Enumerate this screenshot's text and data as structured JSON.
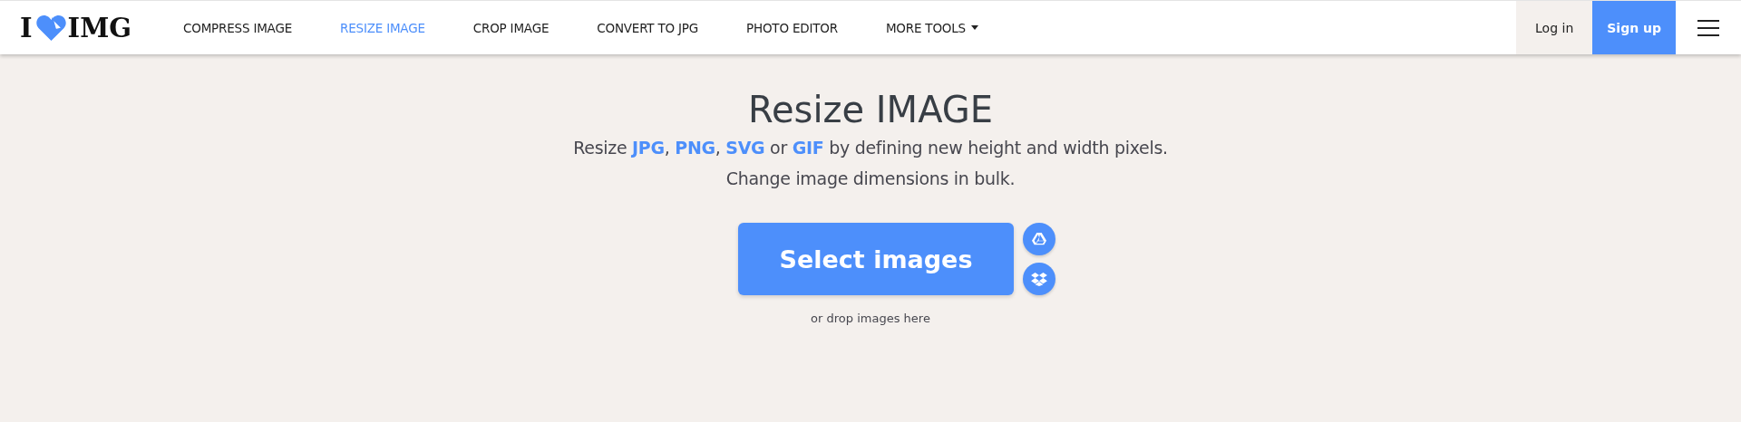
{
  "logo": {
    "left": "I",
    "right": "IMG"
  },
  "nav": [
    {
      "label": "COMPRESS IMAGE",
      "selected": false,
      "dropdown": false
    },
    {
      "label": "RESIZE IMAGE",
      "selected": true,
      "dropdown": false
    },
    {
      "label": "CROP IMAGE",
      "selected": false,
      "dropdown": false
    },
    {
      "label": "CONVERT TO JPG",
      "selected": false,
      "dropdown": false
    },
    {
      "label": "PHOTO EDITOR",
      "selected": false,
      "dropdown": false
    },
    {
      "label": "MORE TOOLS",
      "selected": false,
      "dropdown": true
    }
  ],
  "account": [
    {
      "label": "Log in",
      "kind": "plain"
    },
    {
      "label": "Sign up",
      "kind": "primary"
    }
  ],
  "hero": {
    "title": "Resize IMAGE",
    "subtitle": [
      "Resize **JPG**, **PNG**, **SVG** or **GIF** by defining new height and width pixels.",
      "Change image dimensions in bulk."
    ],
    "button": "Select images",
    "hint": "or drop images here"
  }
}
